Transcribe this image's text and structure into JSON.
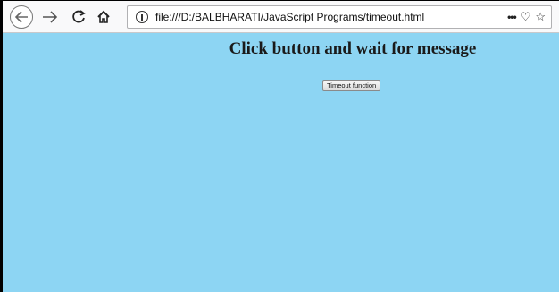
{
  "toolbar": {
    "back_icon": "back-arrow-icon",
    "forward_icon": "forward-arrow-icon",
    "reload_icon": "reload-icon",
    "home_icon": "home-icon"
  },
  "urlbar": {
    "url": "file:///D:/BALBHARATI/JavaScript Programs/timeout.html",
    "info_icon": "info-icon",
    "more_label": "•••",
    "pocket_glyph": "♡",
    "star_glyph": "☆"
  },
  "page": {
    "heading": "Click button and wait for message",
    "button_label": "Timeout function",
    "background_color": "#8dd5f3"
  }
}
